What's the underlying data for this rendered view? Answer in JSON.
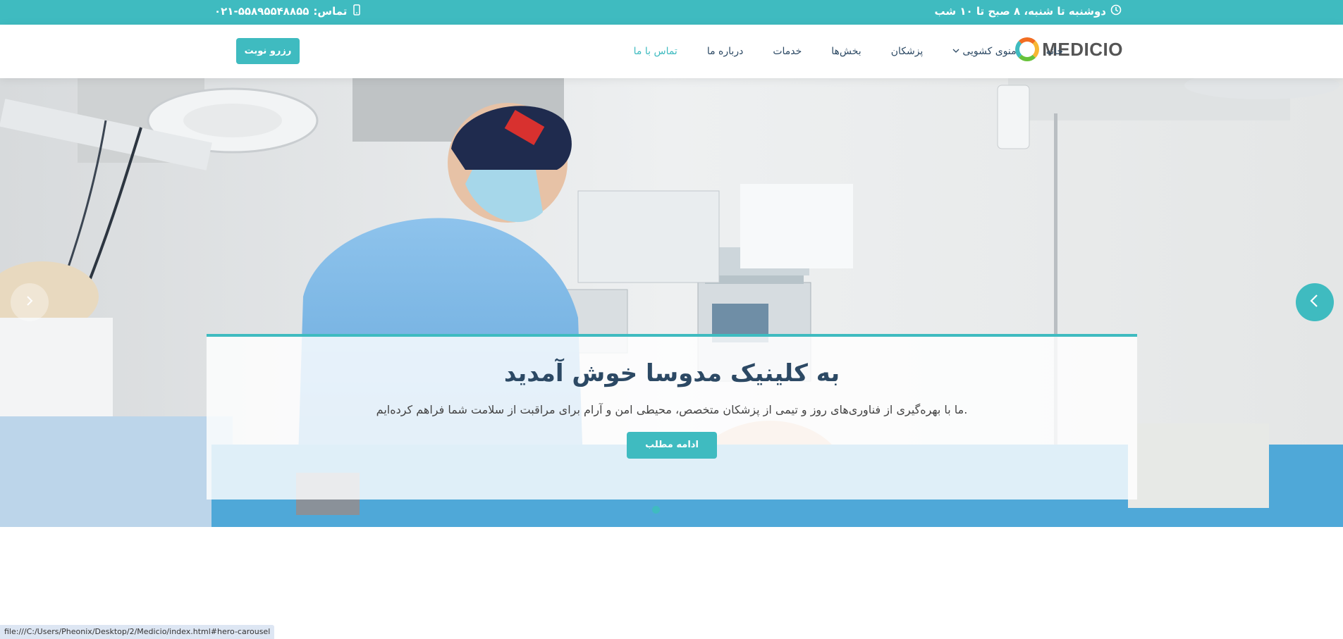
{
  "topbar": {
    "hours": "دوشنبه تا شنبه، ۸ صبح تا ۱۰ شب",
    "hours_icon": "clock-icon",
    "contact_label": "تماس:",
    "contact_phone": "۰۲۱-۵۵۸۹۵۵۴۸۸۵۵",
    "contact_icon": "phone-icon",
    "color": "#3fbbc0"
  },
  "header": {
    "logo_text": "MEDICIO",
    "nav": [
      {
        "label": "خانه"
      },
      {
        "label": "منوی کشویی"
      },
      {
        "label": "پزشکان"
      },
      {
        "label": "بخش‌ها"
      },
      {
        "label": "خدمات"
      },
      {
        "label": "درباره ما"
      },
      {
        "label": "تماس با ما"
      }
    ],
    "appointment_button": "رزرو نوبت"
  },
  "hero": {
    "title": "به کلینیک مدوسا خوش آمدید",
    "subtitle": ".ما با بهره‌گیری از فناوری‌های روز و تیمی از پزشکان متخصص، محیطی امن و آرام برای مراقبت از سلامت شما فراهم کرده‌ایم",
    "read_more": "ادامه مطلب",
    "accent_color": "#3fbbc0"
  },
  "status_bar": {
    "url": "file:///C:/Users/Pheonix/Desktop/2/Medicio/index.html#hero-carousel"
  }
}
